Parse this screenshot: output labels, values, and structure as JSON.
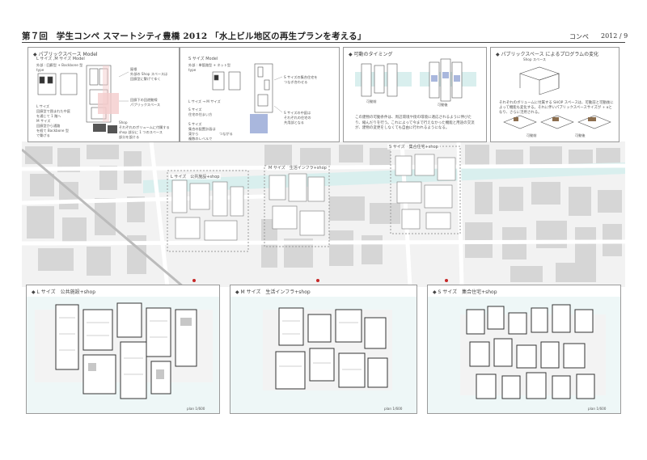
{
  "header": {
    "title": "第７回　学生コンペ スマートシティ豊橋 2012 「水上ビル地区の再生プランを考える」",
    "konpe": "コンペ",
    "date": "2012 / 9"
  },
  "top_panels": [
    {
      "title": "パブリックスペース Model",
      "subtitle": "L サイズ ,M サイズ Model",
      "notes": [
        "外部 : 回廊型 + Backbone 型",
        "type",
        "L サイズ",
        "回廊型で囲まれた中庭",
        "を通じて 1 階へ",
        "M サイズ",
        "回廊型から通路",
        "を経て Backbone 型",
        "で繋げる",
        "屋根",
        "外部の Shop スペースは",
        "回廊型に繋げてゆく",
        "回廊下の回遊動線",
        "パブリックスペース",
        "Shop",
        "それぞれのボリュームに付属する",
        "shop 部分に 1 つのスペース",
        "部分を設ける"
      ]
    },
    {
      "title": "",
      "subtitle": "S サイズ Model",
      "notes": [
        "外部 : 単管路型 + ネット型",
        "type",
        "L サイズ → M サイズ",
        "S サイズ",
        "住宅の住まい方",
        "S サイズ",
        "集合の配置計画は",
        "東から",
        "複数のレベルで",
        "つながる",
        "S サイズの集合住宅を",
        "つなぎ合わせる",
        "S サイズの中庭は",
        "それぞれの住宅の",
        "共用部となる"
      ]
    },
    {
      "title": "可動のタイミング",
      "notes": [
        "可動前",
        "可動後",
        "この建物の可動条件は、周辺環境や街の環境に適応されるように伸びたり、縮んだりを行う。これによって今まで行えなかった機能と用途の交流が、建物の変更をしなくても自由に行われるようになる。"
      ]
    },
    {
      "title": "パブリックスペース によるプログラムの変化",
      "notes": [
        "Shop スペース",
        "それぞれのボリュームに付属する SHOP スペースは、可動前と可動後によって機能も変化する。それに伴いパブリックスペースサイズが + αとなり、さらに活用される。",
        "可動前",
        "可動後"
      ]
    }
  ],
  "map_labels": {
    "l_area": "L サイズ　公共施設+shop",
    "m_area": "M サイズ　生活インフラ+shop",
    "s_area": "S サイズ　集合住宅+shop"
  },
  "bottom_panels": [
    {
      "title": "L サイズ　公共施設+shop",
      "scale": "plan 1/600"
    },
    {
      "title": "M サイズ　生活インフラ+shop",
      "scale": "plan 1/600"
    },
    {
      "title": "S サイズ　集合住宅+shop",
      "scale": "plan 1/600"
    }
  ],
  "colors": {
    "accent_red": "#c62828",
    "water": "#d9efee",
    "building": "#d6d6d6",
    "pink": "#f4cccc",
    "blue_fill": "#a9b7dd"
  }
}
